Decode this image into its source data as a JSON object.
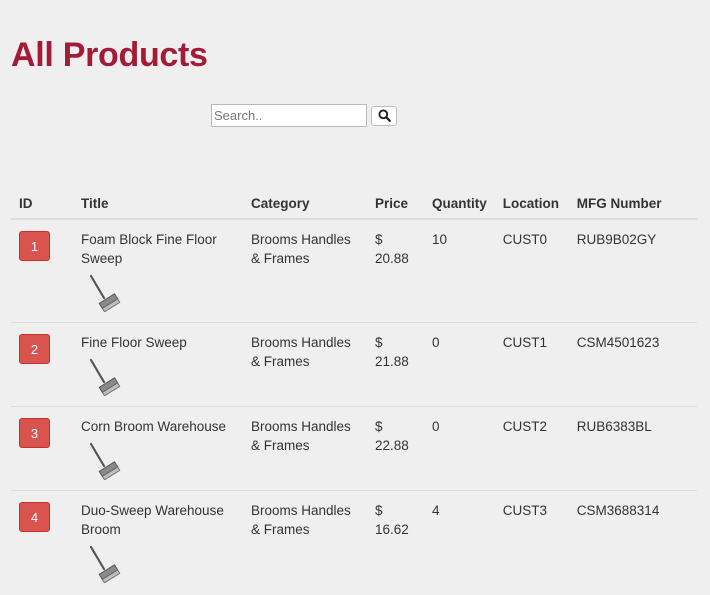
{
  "page": {
    "title": "All Products"
  },
  "search": {
    "placeholder": "Search..",
    "button_icon": "search-icon"
  },
  "table": {
    "headers": {
      "id": "ID",
      "title": "Title",
      "category": "Category",
      "price": "Price",
      "quantity": "Quantity",
      "location": "Location",
      "mfg": "MFG Number"
    },
    "rows": [
      {
        "id": "1",
        "title": "Foam Block Fine Floor Sweep",
        "category": "Brooms Handles & Frames",
        "price": "$ 20.88",
        "quantity": "10",
        "location": "CUST0",
        "mfg": "RUB9B02GY",
        "image": "broom-icon"
      },
      {
        "id": "2",
        "title": "Fine Floor Sweep",
        "category": "Brooms Handles & Frames",
        "price": "$ 21.88",
        "quantity": "0",
        "location": "CUST1",
        "mfg": "CSM4501623",
        "image": "broom-icon"
      },
      {
        "id": "3",
        "title": "Corn Broom Warehouse",
        "category": "Brooms Handles & Frames",
        "price": "$ 22.88",
        "quantity": "0",
        "location": "CUST2",
        "mfg": "RUB6383BL",
        "image": "broom-icon"
      },
      {
        "id": "4",
        "title": "Duo-Sweep Warehouse Broom",
        "category": "Brooms Handles & Frames",
        "price": "$ 16.62",
        "quantity": "4",
        "location": "CUST3",
        "mfg": "CSM3688314",
        "image": "broom-icon"
      }
    ]
  },
  "colors": {
    "title": "#a31c37",
    "badge": "#d9534f",
    "background": "#efefef"
  }
}
